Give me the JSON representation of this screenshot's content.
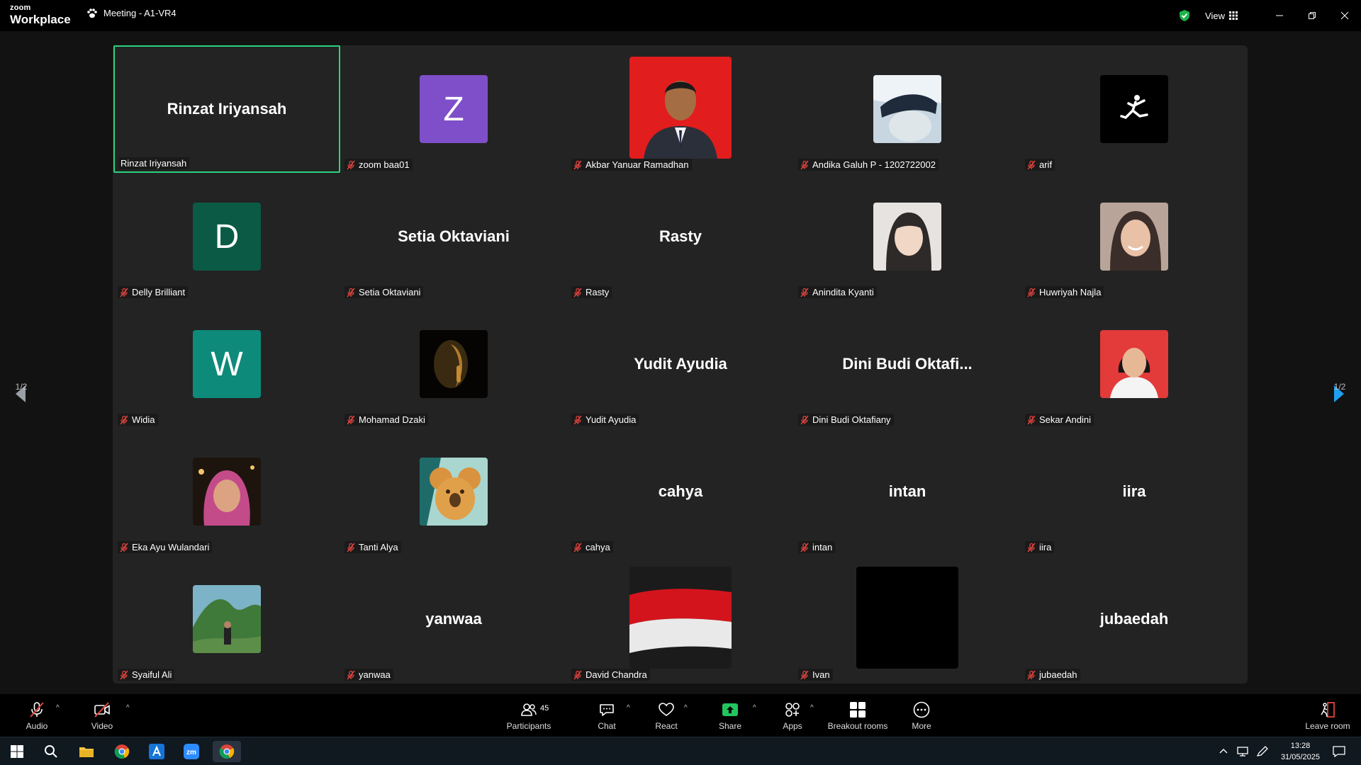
{
  "app": {
    "brand_top": "zoom",
    "brand_bottom": "Workplace",
    "meeting_title": "Meeting - A1-VR4",
    "view_label": "View"
  },
  "pager": {
    "left": "1/2",
    "right": "1/2"
  },
  "participants": [
    {
      "name": "Rinzat Iriyansah",
      "display": "Rinzat Iriyansah",
      "type": "name",
      "muted": false,
      "active": true
    },
    {
      "name": "zoom baa01",
      "type": "letter",
      "letter": "Z",
      "color": "#7f4fc9",
      "muted": true
    },
    {
      "name": "Akbar Yanuar Ramadhan",
      "type": "photo",
      "photo": "red-portrait",
      "muted": true
    },
    {
      "name": "Andika Galuh P - 1202722002",
      "type": "photo",
      "photo": "anime",
      "muted": true
    },
    {
      "name": "arif",
      "type": "photo",
      "photo": "jumpman",
      "muted": true
    },
    {
      "name": "Delly Brilliant",
      "type": "letter",
      "letter": "D",
      "color": "#0b5a45",
      "muted": true
    },
    {
      "name": "Setia Oktaviani",
      "display": "Setia Oktaviani",
      "type": "name",
      "muted": true
    },
    {
      "name": "Rasty",
      "display": "Rasty",
      "type": "name",
      "muted": true
    },
    {
      "name": "Anindita Kyanti",
      "type": "photo",
      "photo": "girl-light",
      "muted": true
    },
    {
      "name": "Huwriyah Najla",
      "type": "photo",
      "photo": "girl-smile",
      "muted": true
    },
    {
      "name": "Widia",
      "type": "letter",
      "letter": "W",
      "color": "#0e8a7a",
      "muted": true
    },
    {
      "name": "Mohamad Dzaki",
      "type": "photo",
      "photo": "dark-face",
      "muted": true
    },
    {
      "name": "Yudit Ayudia",
      "display": "Yudit Ayudia",
      "type": "name",
      "muted": true
    },
    {
      "name": "Dini Budi Oktafiany",
      "display": "Dini Budi Oktafi...",
      "type": "name",
      "muted": true
    },
    {
      "name": "Sekar Andini",
      "type": "photo",
      "photo": "red-girl",
      "muted": true
    },
    {
      "name": "Eka Ayu Wulandari",
      "type": "photo",
      "photo": "hijab",
      "muted": true
    },
    {
      "name": "Tanti Alya",
      "type": "photo",
      "photo": "koala",
      "muted": true
    },
    {
      "name": "cahya",
      "display": "cahya",
      "type": "name",
      "muted": true
    },
    {
      "name": "intan",
      "display": "intan",
      "type": "name",
      "muted": true
    },
    {
      "name": "iira",
      "display": "iira",
      "type": "name",
      "muted": true
    },
    {
      "name": "Syaiful Ali",
      "type": "photo",
      "photo": "landscape",
      "muted": true
    },
    {
      "name": "yanwaa",
      "display": "yanwaa",
      "type": "name",
      "muted": true
    },
    {
      "name": "David Chandra",
      "type": "photo",
      "photo": "flag",
      "muted": true
    },
    {
      "name": "Ivan",
      "type": "photo",
      "photo": "black",
      "muted": true
    },
    {
      "name": "jubaedah",
      "display": "jubaedah",
      "type": "name",
      "muted": true
    }
  ],
  "toolbar": {
    "audio": "Audio",
    "video": "Video",
    "participants": "Participants",
    "participants_count": "45",
    "chat": "Chat",
    "react": "React",
    "share": "Share",
    "apps": "Apps",
    "breakout": "Breakout rooms",
    "more": "More",
    "leave": "Leave room"
  },
  "taskbar": {
    "time": "13:28",
    "date": "31/05/2025"
  },
  "colors": {
    "active_border": "#2ad37f",
    "share_green": "#22c55e",
    "mute_red": "#e0443e",
    "next_arrow": "#1e9ef0"
  }
}
